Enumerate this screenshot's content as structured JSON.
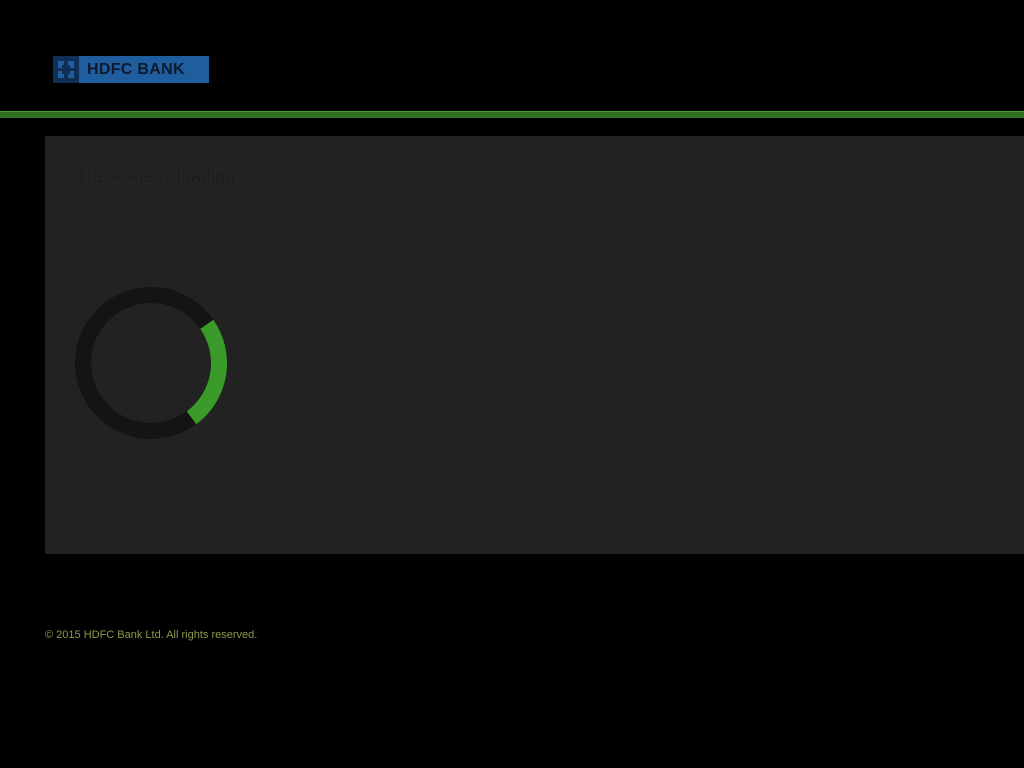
{
  "header": {
    "logo_text": "HDFC BANK",
    "logo_icon": "hdfc-logo-mark-icon",
    "accent_color": "#2f6f1f"
  },
  "main": {
    "status_text": "The Page is loading",
    "spinner_icon": "loading-spinner-icon",
    "spinner_color": "#3a9a2a"
  },
  "footer": {
    "copyright": "© 2015 HDFC Bank Ltd. All rights reserved."
  }
}
